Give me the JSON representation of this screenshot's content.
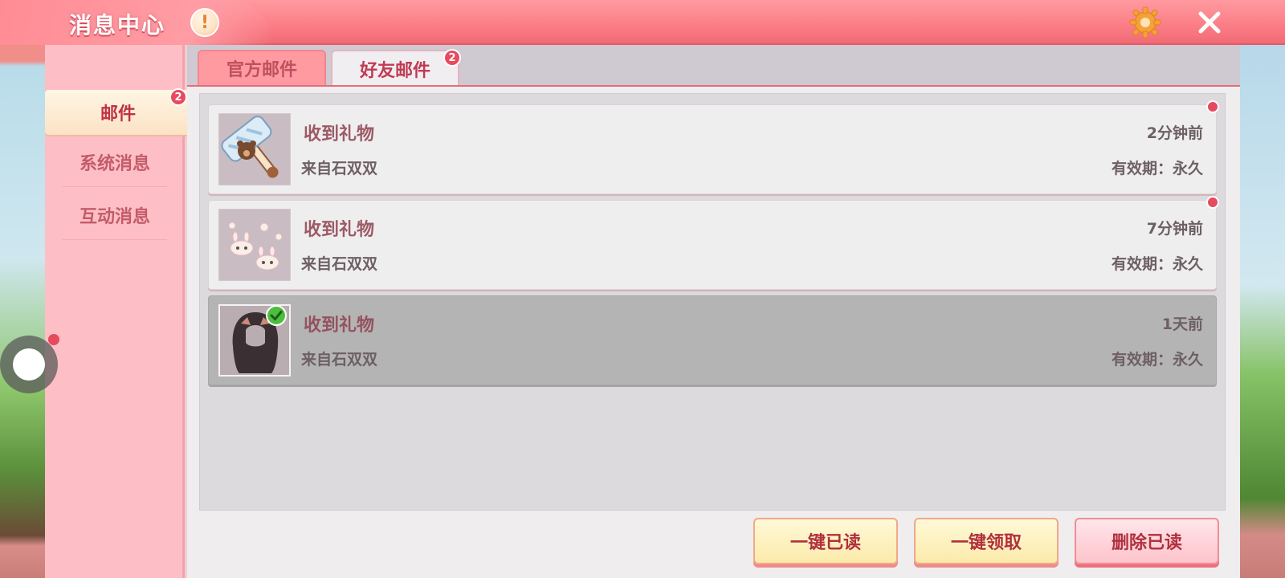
{
  "header": {
    "title": "消息中心",
    "info_icon": "exclamation-icon",
    "settings_icon": "gear-icon",
    "close_icon": "close-icon"
  },
  "sidebar": {
    "items": [
      {
        "label": "邮件",
        "active": true,
        "badge": "2"
      },
      {
        "label": "系统消息",
        "active": false
      },
      {
        "label": "互动消息",
        "active": false
      }
    ]
  },
  "tabs": [
    {
      "label": "官方邮件",
      "active": false
    },
    {
      "label": "好友邮件",
      "active": true,
      "badge": "2"
    }
  ],
  "mails": [
    {
      "title": "收到礼物",
      "from": "来自石双双",
      "time": "2分钟前",
      "validity": "有效期：永久",
      "unread": true,
      "item": "hammer-gift-icon",
      "claimed": false
    },
    {
      "title": "收到礼物",
      "from": "来自石双双",
      "time": "7分钟前",
      "validity": "有效期：永久",
      "unread": true,
      "item": "bunny-face-gift-icon",
      "claimed": false
    },
    {
      "title": "收到礼物",
      "from": "来自石双双",
      "time": "1天前",
      "validity": "有效期：永久",
      "unread": false,
      "item": "hair-gift-icon",
      "claimed": true
    }
  ],
  "actions": {
    "read_all": "一键已读",
    "claim_all": "一键领取",
    "delete_read": "删除已读"
  },
  "colors": {
    "header": "#fb7d86",
    "accent": "#e84a5f",
    "sidebar": "#fdbfc5"
  }
}
